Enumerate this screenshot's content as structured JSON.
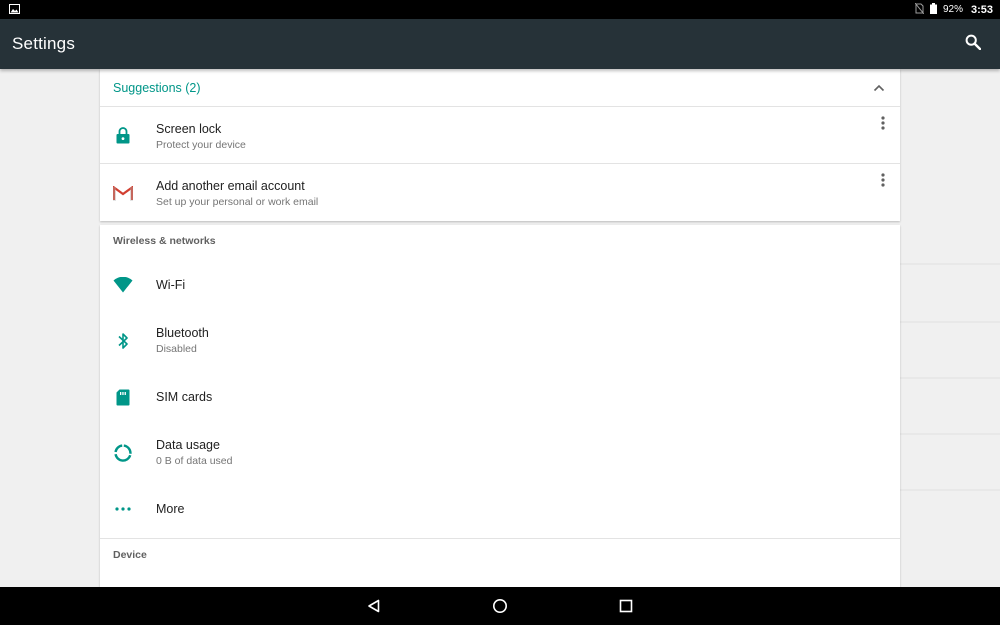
{
  "statusbar": {
    "battery_percent": "92%",
    "time": "3:53",
    "left_icon": "image-notification-icon",
    "signal_icon": "no-sim-icon",
    "battery_icon": "battery-icon"
  },
  "appbar": {
    "title": "Settings",
    "search_icon": "search-icon"
  },
  "suggestions": {
    "header": "Suggestions (2)",
    "items": [
      {
        "title": "Screen lock",
        "subtitle": "Protect your device",
        "icon": "lock-icon"
      },
      {
        "title": "Add another email account",
        "subtitle": "Set up your personal or work email",
        "icon": "gmail-icon"
      }
    ]
  },
  "wireless": {
    "header": "Wireless & networks",
    "items": [
      {
        "title": "Wi-Fi",
        "subtitle": "",
        "icon": "wifi-icon"
      },
      {
        "title": "Bluetooth",
        "subtitle": "Disabled",
        "icon": "bluetooth-icon"
      },
      {
        "title": "SIM cards",
        "subtitle": "",
        "icon": "sim-card-icon"
      },
      {
        "title": "Data usage",
        "subtitle": "0 B of data used",
        "icon": "data-usage-icon"
      },
      {
        "title": "More",
        "subtitle": "",
        "icon": "more-dots-icon"
      }
    ]
  },
  "device": {
    "header": "Device"
  },
  "navbar": {
    "back_icon": "back-icon",
    "home_icon": "home-icon",
    "recents_icon": "recents-icon"
  },
  "colors": {
    "accent": "#009688",
    "appbar": "#263238",
    "background": "#f0f0f0"
  }
}
